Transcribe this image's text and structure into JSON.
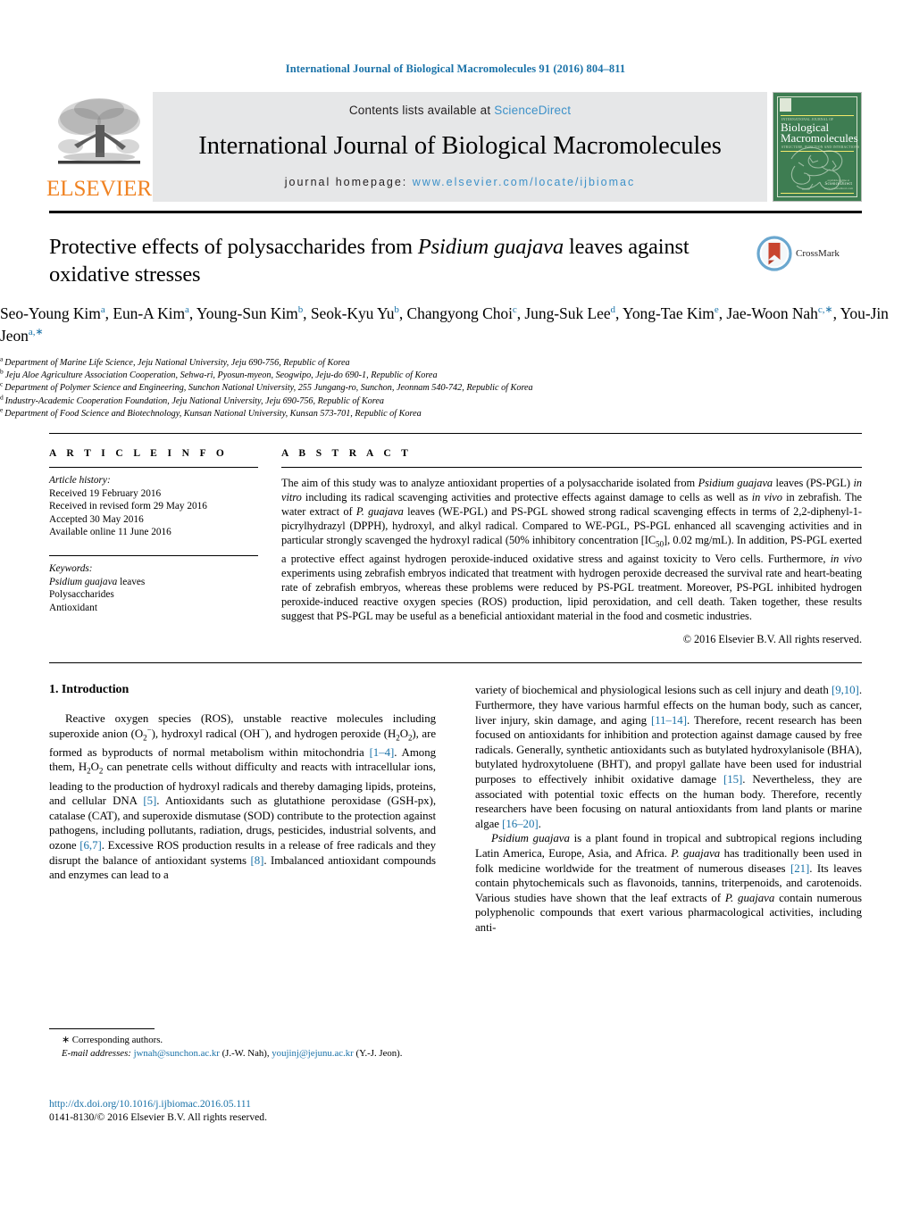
{
  "running_head": "International Journal of Biological Macromolecules 91 (2016) 804–811",
  "masthead": {
    "contents_prefix": "Contents lists available at ",
    "contents_link": "ScienceDirect",
    "journal_title": "International Journal of Biological Macromolecules",
    "homepage_prefix": "journal homepage: ",
    "homepage_url": "www.elsevier.com/locate/ijbiomac",
    "publisher_wordmark": "ELSEVIER",
    "cover": {
      "kicker": "INTERNATIONAL JOURNAL OF",
      "line1": "Biological",
      "line2": "Macromolecules",
      "subtitle": "STRUCTURE, FUNCTION AND INTERACTIONS",
      "footer_label": "available online at",
      "footer_brand": "ScienceDirect",
      "footer_url": "www.sciencedirect.com"
    }
  },
  "article": {
    "title_part1": "Protective effects of polysaccharides from ",
    "title_italic": "Psidium guajava",
    "title_part2": " leaves against oxidative stresses",
    "crossmark_label": "CrossMark",
    "authors": [
      {
        "name": "Seo-Young Kim",
        "marks": "a",
        "sep": ", "
      },
      {
        "name": "Eun-A Kim",
        "marks": "a",
        "sep": ", "
      },
      {
        "name": "Young-Sun Kim",
        "marks": "b",
        "sep": ", "
      },
      {
        "name": "Seok-Kyu Yu",
        "marks": "b",
        "sep": ", "
      },
      {
        "name": "Changyong Choi",
        "marks": "c",
        "sep": ", "
      },
      {
        "name": "Jung-Suk Lee",
        "marks": "d",
        "sep": ", "
      },
      {
        "name": "Yong-Tae Kim",
        "marks": "e",
        "sep": ", "
      },
      {
        "name": "Jae-Woon Nah",
        "marks": "c,∗",
        "sep": ", "
      },
      {
        "name": "You-Jin Jeon",
        "marks": "a,∗",
        "sep": ""
      }
    ],
    "affiliations": [
      {
        "mark": "a",
        "text": "Department of Marine Life Science, Jeju National University, Jeju 690-756, Republic of Korea"
      },
      {
        "mark": "b",
        "text": "Jeju Aloe Agriculture Association Cooperation, Sehwa-ri, Pyosun-myeon, Seogwipo, Jeju-do 690-1, Republic of Korea"
      },
      {
        "mark": "c",
        "text": "Department of Polymer Science and Engineering, Sunchon National University, 255 Jungang-ro, Sunchon, Jeonnam 540-742, Republic of Korea"
      },
      {
        "mark": "d",
        "text": "Industry-Academic Cooperation Foundation, Jeju National University, Jeju 690-756, Republic of Korea"
      },
      {
        "mark": "e",
        "text": "Department of Food Science and Biotechnology, Kunsan National University, Kunsan 573-701, Republic of Korea"
      }
    ]
  },
  "article_info": {
    "heading": "A R T I C L E I N F O",
    "history_label": "Article history:",
    "history": [
      "Received 19 February 2016",
      "Received in revised form 29 May 2016",
      "Accepted 30 May 2016",
      "Available online 11 June 2016"
    ],
    "keywords_label": "Keywords:",
    "keywords": [
      "Psidium guajava leaves",
      "Polysaccharides",
      "Antioxidant"
    ]
  },
  "abstract": {
    "heading": "A B S T R A C T",
    "copyright": "© 2016 Elsevier B.V. All rights reserved."
  },
  "introduction": {
    "heading": "1. Introduction"
  },
  "footnote": {
    "corresponding": "∗ Corresponding authors.",
    "email_label": "E-mail addresses:",
    "email1": "jwnah@sunchon.ac.kr",
    "email1_owner": "(J.-W. Nah)",
    "email2": "youjinj@jejunu.ac.kr",
    "email2_owner": "(Y.-J. Jeon).",
    "doi": "http://dx.doi.org/10.1016/j.ijbiomac.2016.05.111",
    "issn_line": "0141-8130/© 2016 Elsevier B.V. All rights reserved."
  },
  "colors": {
    "link_blue": "#1a72a8",
    "sciencedirect_blue": "#3d91c9",
    "elsevier_orange": "#f08323",
    "banner_gray": "#e6e7e8",
    "cover_green": "#3e7d52"
  }
}
